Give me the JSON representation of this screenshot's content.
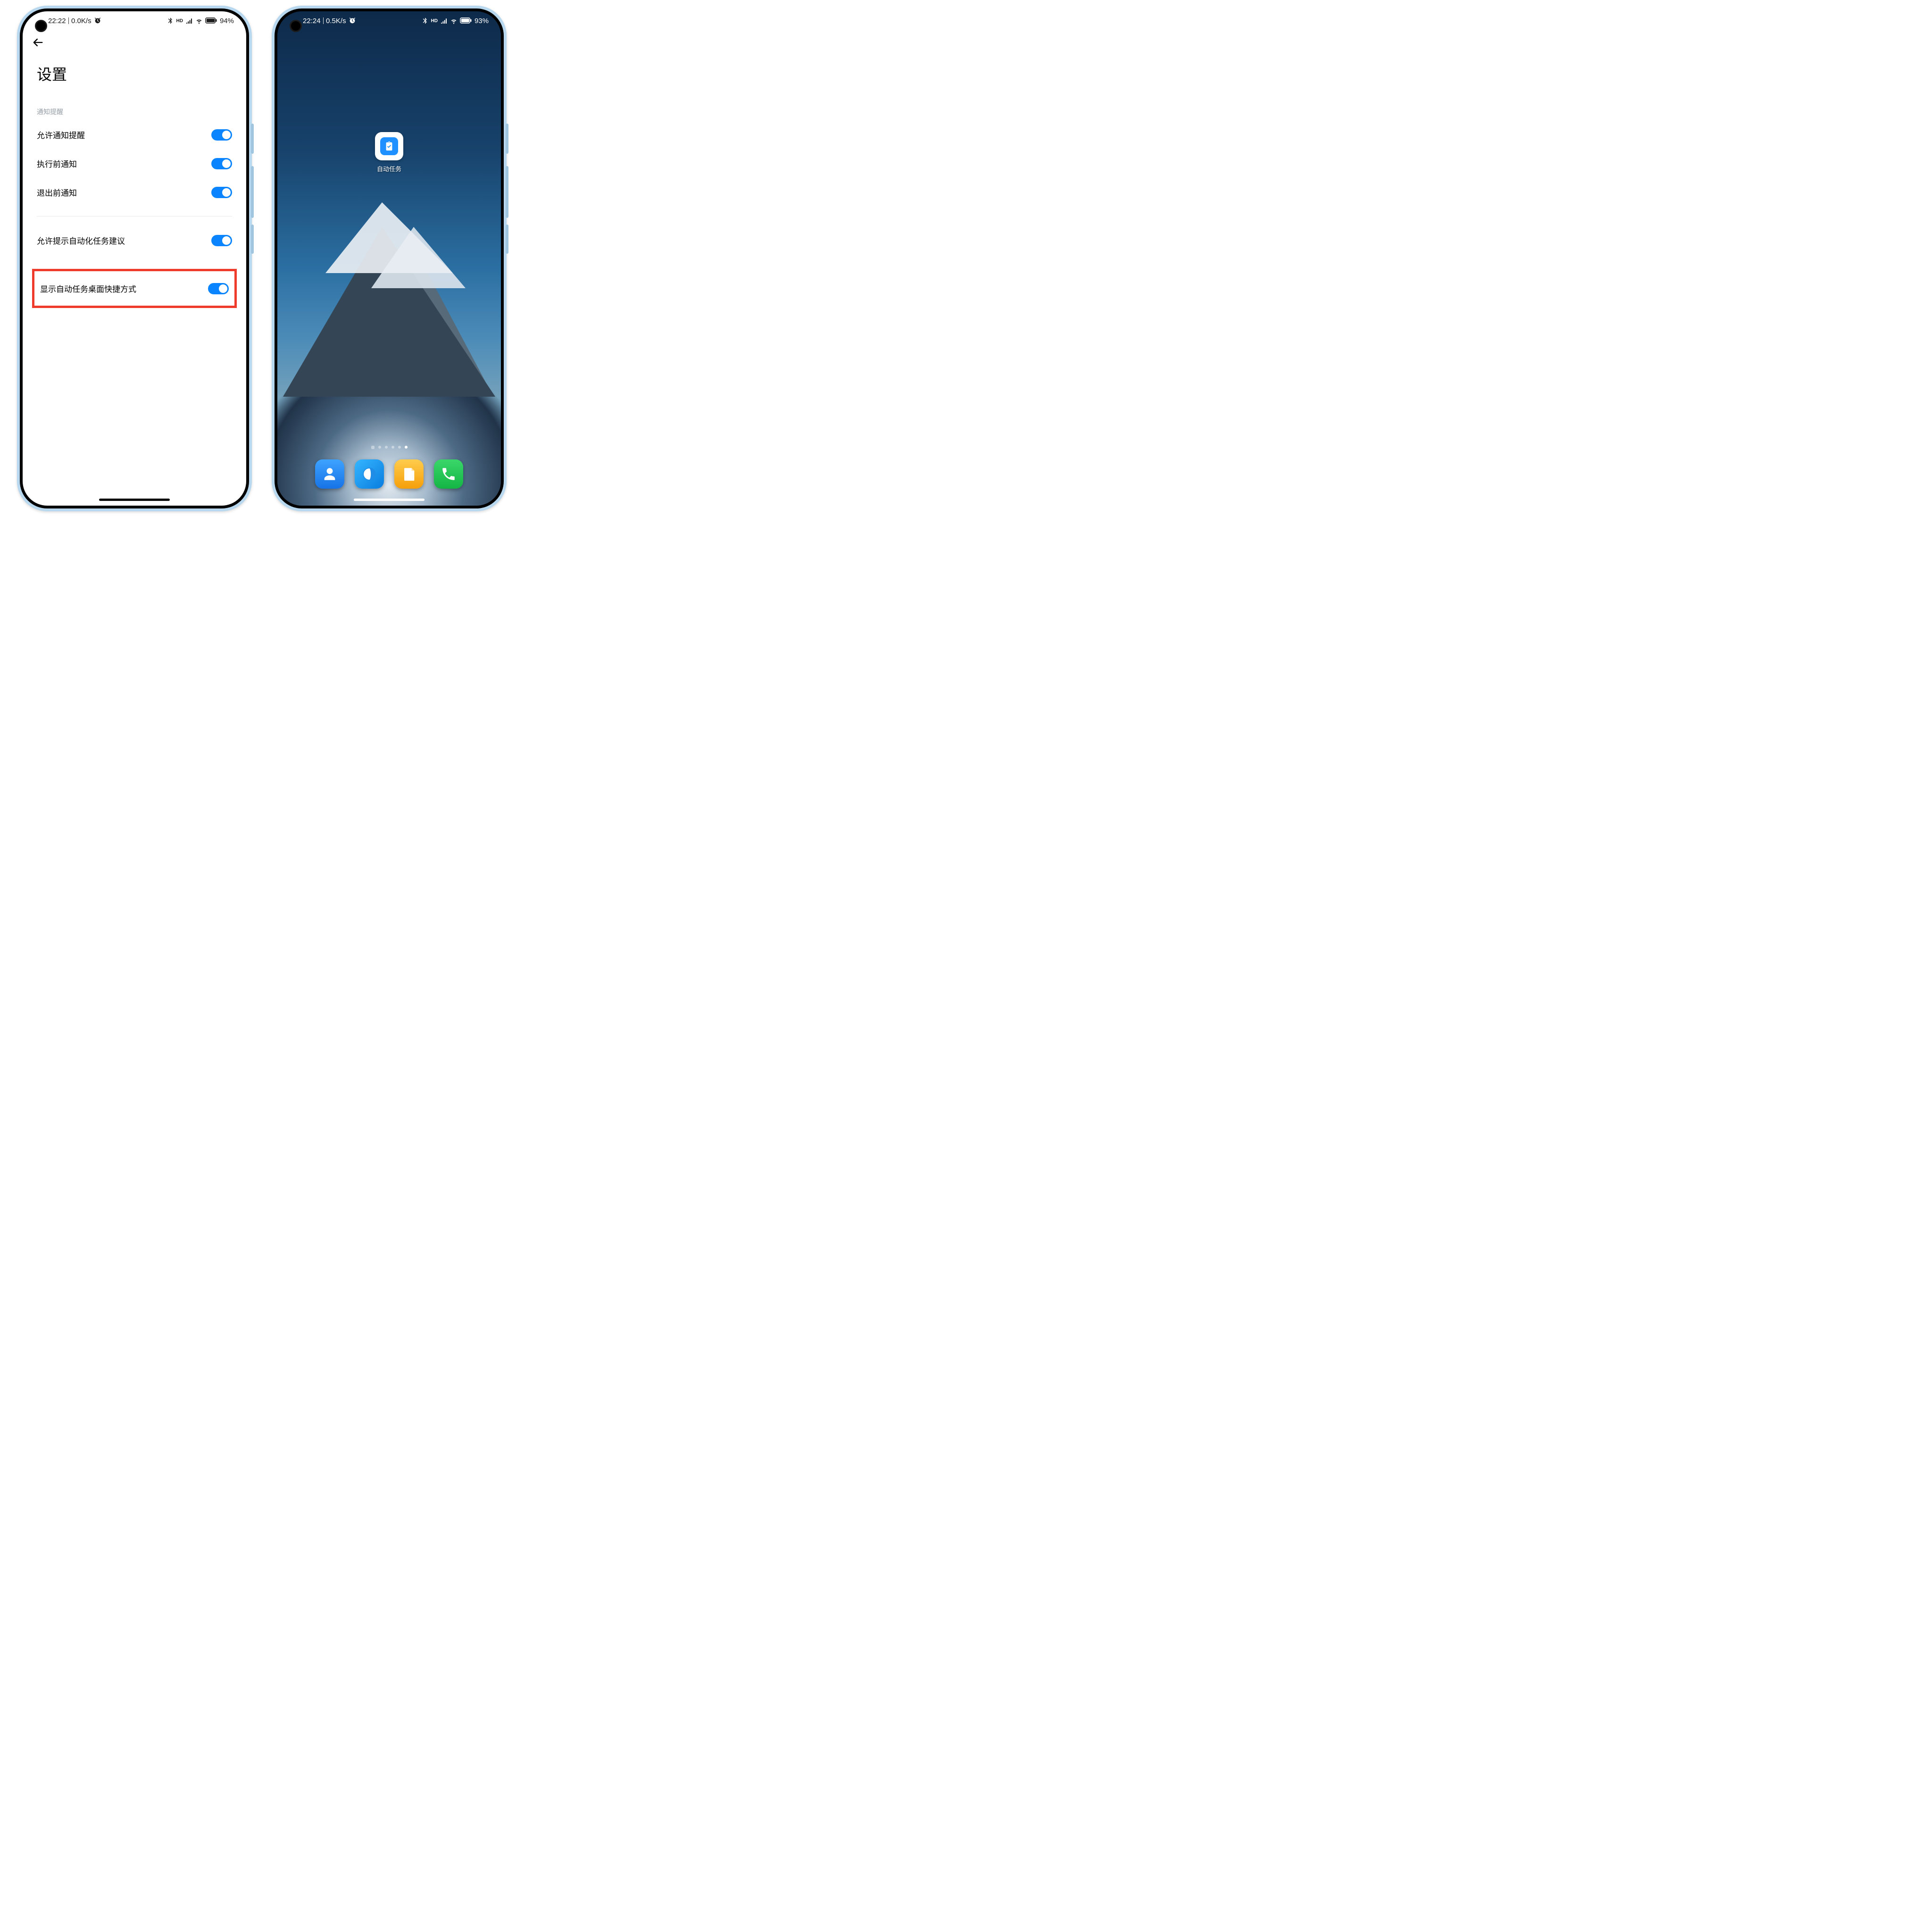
{
  "left": {
    "status": {
      "time": "22:22",
      "net": "0.0K/s",
      "battery": "94"
    },
    "page_title": "设置",
    "section_label": "通知提醒",
    "rows": {
      "allow_notify": "允许通知提醒",
      "before_exec": "执行前通知",
      "before_exit": "退出前通知",
      "allow_suggest": "允许提示自动化任务建议",
      "show_shortcut": "显示自动任务桌面快捷方式"
    }
  },
  "right": {
    "status": {
      "time": "22:24",
      "net": "0.5K/s",
      "battery": "93"
    },
    "app_label": "自动任务",
    "dock": {
      "contacts": "contacts-icon",
      "browser": "browser-icon",
      "notes": "notes-icon",
      "phone": "phone-icon"
    }
  },
  "glyphs": {
    "percent": "%",
    "hd": "HD"
  }
}
